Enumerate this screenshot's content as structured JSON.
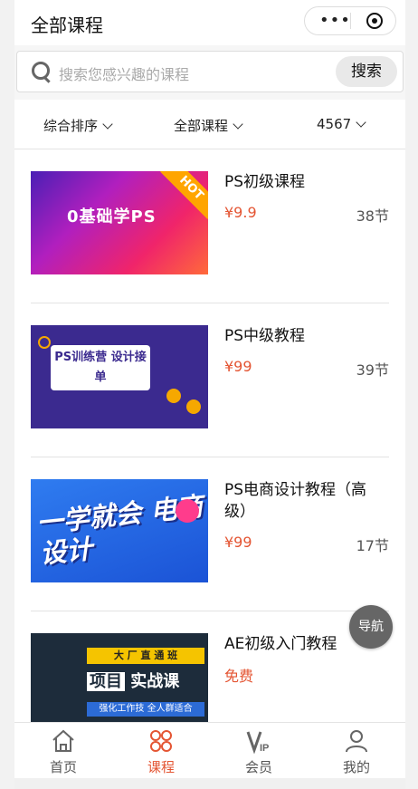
{
  "header": {
    "title": "全部课程"
  },
  "search": {
    "placeholder": "搜索您感兴趣的课程",
    "button_label": "搜索"
  },
  "filters": [
    {
      "label": "综合排序"
    },
    {
      "label": "全部课程"
    },
    {
      "label": "4567"
    }
  ],
  "courses": [
    {
      "title": "PS初级课程",
      "price": "¥9.9",
      "lessons": "38节",
      "thumb_text": "0基础学PS",
      "badge": "HOT"
    },
    {
      "title": "PS中级教程",
      "price": "¥99",
      "lessons": "39节",
      "thumb_text": "PS训练营 设计接单"
    },
    {
      "title": "PS电商设计教程（高级）",
      "price": "¥99",
      "lessons": "17节",
      "thumb_text": "一学就会 电商设计"
    },
    {
      "title": "AE初级入门教程",
      "price": "免费",
      "lessons": "",
      "thumb_banner": "大 厂 直 通 班",
      "thumb_main_a": "项目",
      "thumb_main_b": "实战课",
      "thumb_sub": "强化工作技  全人群适合"
    }
  ],
  "floating_nav": {
    "label": "导航"
  },
  "tabbar": [
    {
      "label": "首页",
      "icon": "home-icon"
    },
    {
      "label": "课程",
      "icon": "courses-icon",
      "active": true
    },
    {
      "label": "会员",
      "icon": "vip-icon"
    },
    {
      "label": "我的",
      "icon": "profile-icon"
    }
  ],
  "colors": {
    "accent": "#e45533",
    "tab_inactive": "#555555",
    "badge": "#ffa500"
  }
}
